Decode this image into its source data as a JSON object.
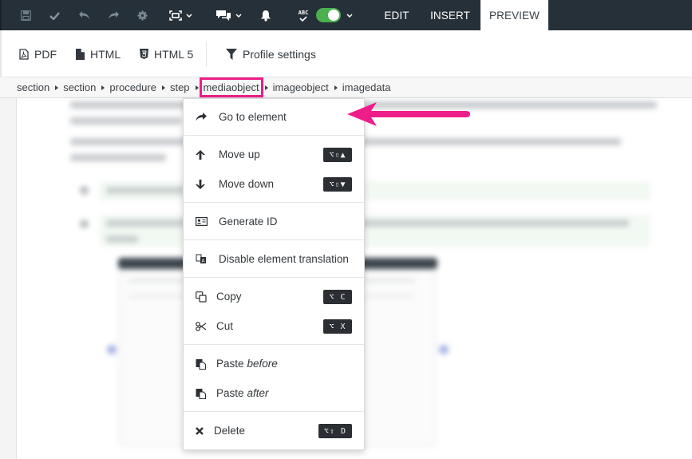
{
  "topbar": {
    "icons": [
      "save-icon",
      "check-icon",
      "undo-icon",
      "redo-icon",
      "gear-icon",
      "fullscreen-icon",
      "comments-icon",
      "bell-icon",
      "spellcheck-icon"
    ],
    "spellcheck_label": "ABC",
    "spellcheck_enabled": true,
    "toggle_color": "#4caf50",
    "tabs": [
      {
        "label": "EDIT",
        "active": false
      },
      {
        "label": "INSERT",
        "active": false
      },
      {
        "label": "PREVIEW",
        "active": true
      }
    ],
    "background": "#263038"
  },
  "preview_toolbar": {
    "buttons": [
      {
        "label": "PDF",
        "icon": "pdf-file-icon"
      },
      {
        "label": "HTML",
        "icon": "file-icon"
      },
      {
        "label": "HTML 5",
        "icon": "html5-icon"
      },
      {
        "label": "Profile settings",
        "icon": "filter-icon"
      }
    ]
  },
  "breadcrumb": {
    "items": [
      "section",
      "section",
      "procedure",
      "step",
      "mediaobject",
      "imageobject",
      "imagedata"
    ],
    "highlighted_index": 4,
    "highlight_color": "#ee1d8a"
  },
  "context_menu": {
    "groups": [
      [
        {
          "label": "Go to element",
          "icon": "share-arrow-icon"
        }
      ],
      [
        {
          "label": "Move up",
          "icon": "arrow-up-icon",
          "shortcut": "⌥⇧▲"
        },
        {
          "label": "Move down",
          "icon": "arrow-down-icon",
          "shortcut": "⌥⇧▼"
        }
      ],
      [
        {
          "label": "Generate ID",
          "icon": "id-card-icon"
        }
      ],
      [
        {
          "label": "Disable element translation",
          "icon": "translate-icon"
        }
      ],
      [
        {
          "label": "Copy",
          "icon": "copy-icon",
          "shortcut": "⌥ C"
        },
        {
          "label": "Cut",
          "icon": "scissors-icon",
          "shortcut": "⌥ X"
        }
      ],
      [
        {
          "label": "Paste",
          "label_em": "before",
          "icon": "paste-icon"
        },
        {
          "label": "Paste",
          "label_em": "after",
          "icon": "paste-icon"
        }
      ],
      [
        {
          "label": "Delete",
          "icon": "close-icon",
          "shortcut": "⌥⇧ D"
        }
      ]
    ]
  },
  "annotation": {
    "arrow_color": "#ee1d8a",
    "points_to": "Go to element"
  }
}
